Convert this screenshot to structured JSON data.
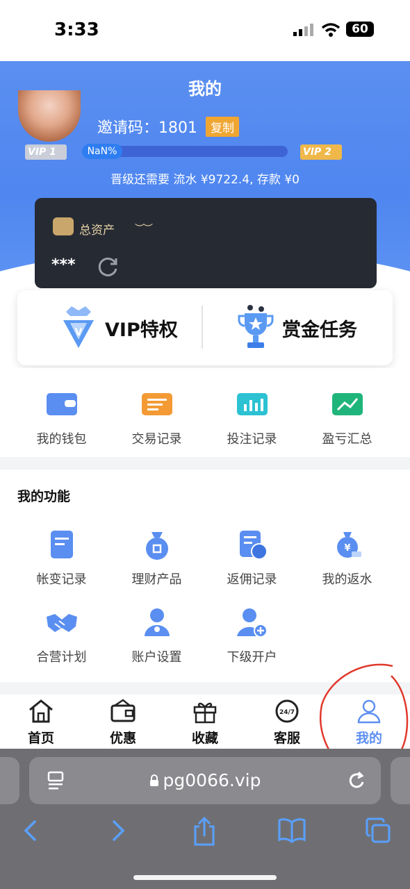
{
  "status_bar": {
    "time": "3:33",
    "battery": "60"
  },
  "header": {
    "title": "我的"
  },
  "profile": {
    "invite_label": "邀请码：1801",
    "copy_label": "复制",
    "current_level": "VIP 1",
    "next_level": "VIP 2",
    "progress_text": "NaN%",
    "upgrade_text": "晋级还需要 流水 ¥9722.4, 存款 ¥0"
  },
  "assets": {
    "label": "总资产",
    "masked_value": "***"
  },
  "promo_cards": [
    {
      "label": "VIP特权",
      "icon": "vip-diamond-icon"
    },
    {
      "label": "赏金任务",
      "icon": "trophy-icon"
    }
  ],
  "quick_links": [
    {
      "label": "我的钱包",
      "icon": "wallet-icon"
    },
    {
      "label": "交易记录",
      "icon": "transaction-icon"
    },
    {
      "label": "投注记录",
      "icon": "bet-record-icon"
    },
    {
      "label": "盈亏汇总",
      "icon": "profit-chart-icon"
    }
  ],
  "functions": {
    "title": "我的功能",
    "items": [
      {
        "label": "帐变记录",
        "icon": "account-change-icon"
      },
      {
        "label": "理财产品",
        "icon": "money-bag-icon"
      },
      {
        "label": "返佣记录",
        "icon": "rebate-record-icon"
      },
      {
        "label": "我的返水",
        "icon": "cashback-icon"
      },
      {
        "label": "合营计划",
        "icon": "handshake-icon"
      },
      {
        "label": "账户设置",
        "icon": "user-settings-icon"
      },
      {
        "label": "下级开户",
        "icon": "add-user-icon"
      }
    ]
  },
  "tabbar": [
    {
      "label": "首页",
      "icon": "home-icon"
    },
    {
      "label": "优惠",
      "icon": "wallet-promo-icon"
    },
    {
      "label": "收藏",
      "icon": "gift-icon"
    },
    {
      "label": "客服",
      "icon": "support-247-icon"
    },
    {
      "label": "我的",
      "icon": "person-icon",
      "active": true
    }
  ],
  "browser": {
    "url": "pg0066.vip"
  },
  "colors": {
    "primary": "#5d8ff2",
    "accent": "#f0a632",
    "card_dark": "#262a33"
  }
}
